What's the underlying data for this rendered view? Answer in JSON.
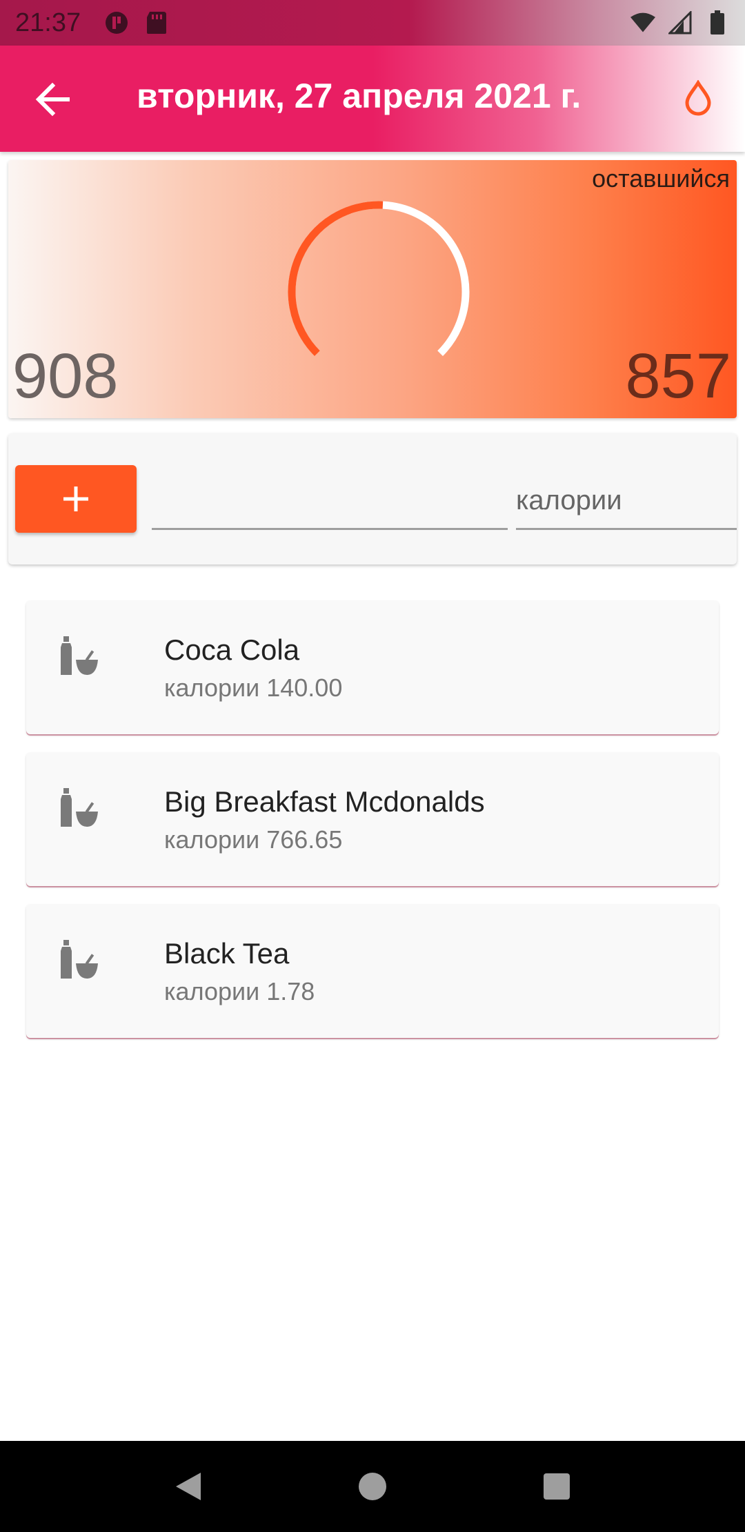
{
  "status_bar": {
    "time": "21:37"
  },
  "app_bar": {
    "title": "вторник, 27 апреля 2021 г.",
    "back_icon": "arrow-back-icon",
    "water_icon": "water-drop-icon"
  },
  "summary": {
    "remaining_label": "оставшийся",
    "left_value": "908",
    "right_value": "857",
    "gauge_consumed_fraction": 0.51
  },
  "input": {
    "add_label": "+",
    "name_value": "",
    "calories_placeholder": "калории"
  },
  "foods": [
    {
      "name": "Coca Cola",
      "calories": "калории 140.00"
    },
    {
      "name": "Big Breakfast Mcdonalds",
      "calories": "калории 766.65"
    },
    {
      "name": "Black Tea",
      "calories": "калории 1.78"
    }
  ],
  "colors": {
    "primary": "#e91e63",
    "accent": "#ff5722"
  }
}
